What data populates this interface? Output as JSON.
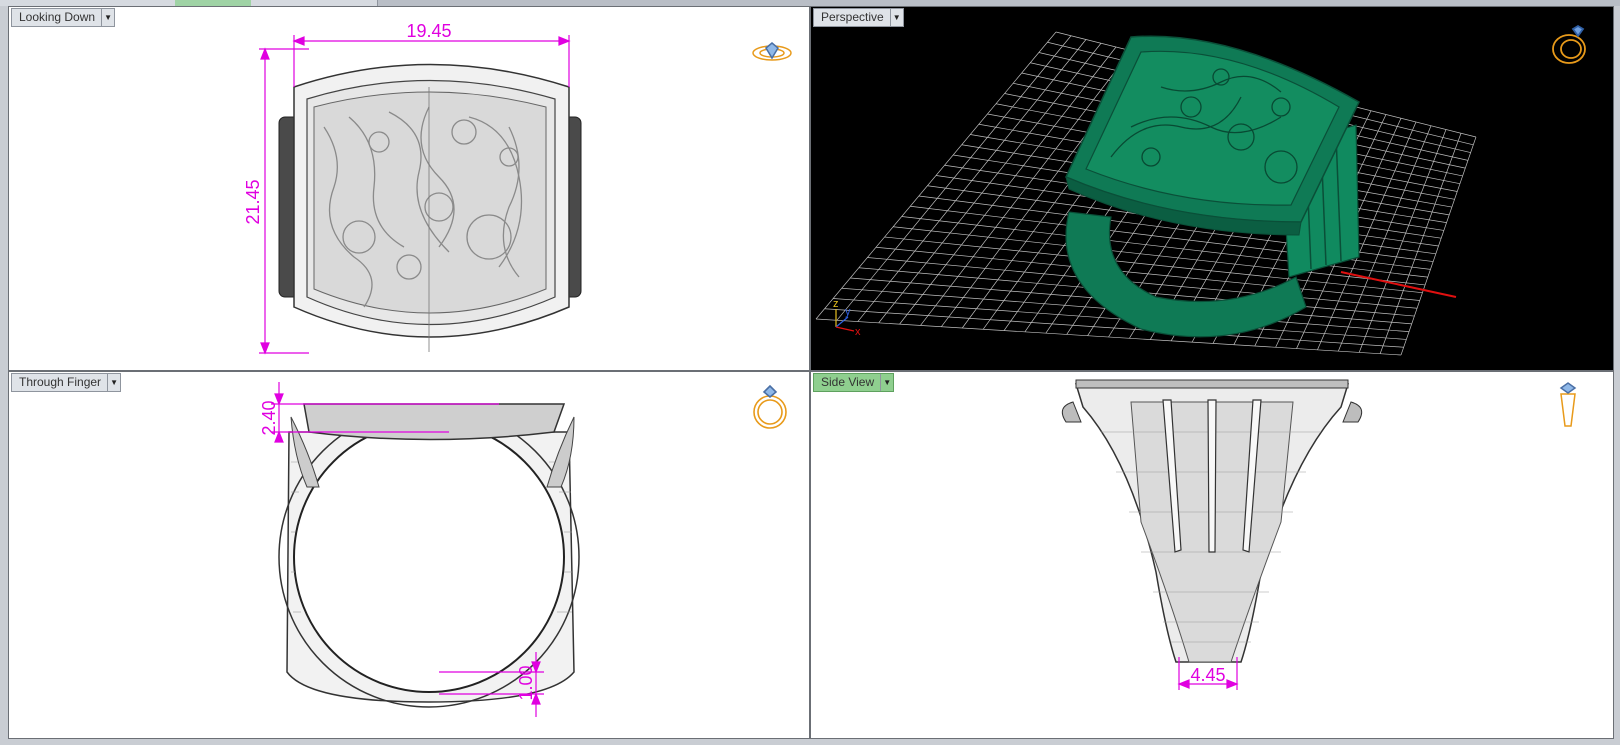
{
  "viewports": {
    "top_left": {
      "label": "Looking Down"
    },
    "top_right": {
      "label": "Perspective"
    },
    "bottom_left": {
      "label": "Through Finger"
    },
    "bottom_right": {
      "label": "Side View",
      "active": true
    }
  },
  "dimensions": {
    "top_width": "19.45",
    "top_height": "21.45",
    "finger_top": "2.40",
    "finger_bottom": "1.00",
    "side_bottom": "4.45"
  },
  "axis_labels": {
    "z": "z",
    "y": "y",
    "x": "x"
  },
  "colors": {
    "dimension": "#e000e0",
    "ring_green": "#0f7a55",
    "grid_line": "#bfbfbf",
    "axis_x": "#e01010",
    "active_view": "#8fcf8f"
  },
  "icons": [
    "dropdown-arrow-icon",
    "gem-ring-icon",
    "perspective-ring-icon",
    "ring-front-icon",
    "ring-side-icon"
  ]
}
